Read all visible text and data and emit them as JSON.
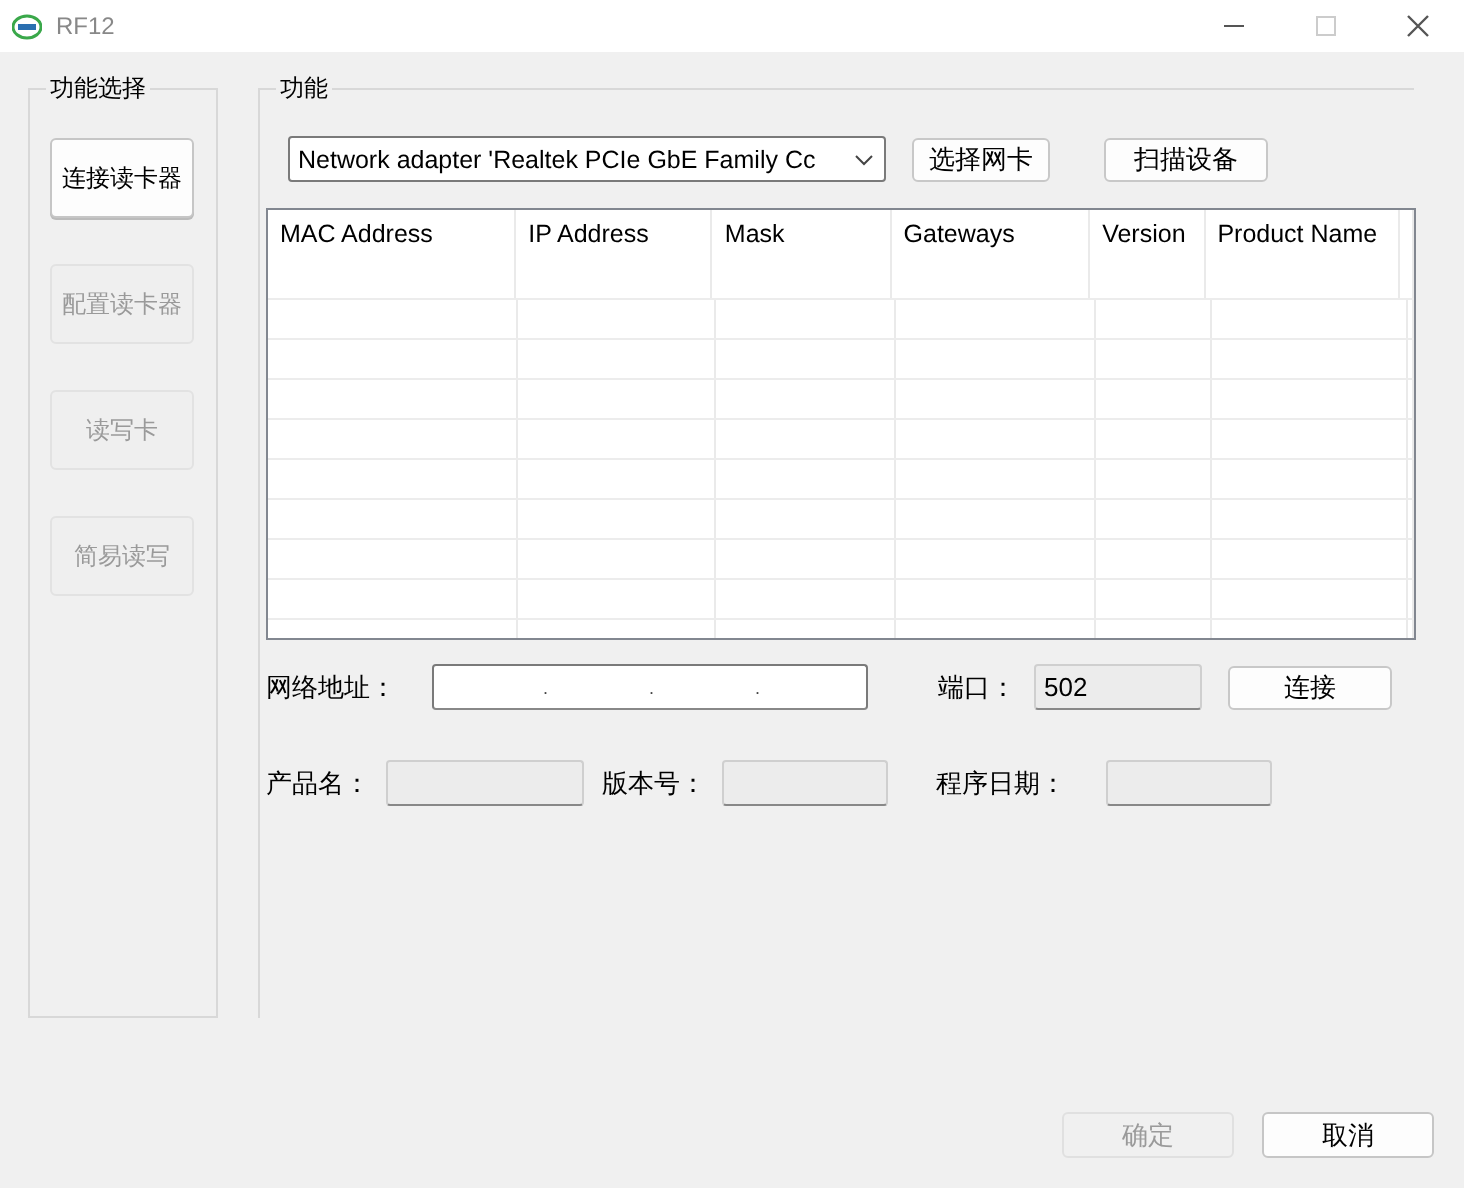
{
  "window": {
    "title": "RF12"
  },
  "sidebar": {
    "title": "功能选择",
    "items": [
      {
        "label": "连接读卡器",
        "selected": true,
        "disabled": false
      },
      {
        "label": "配置读卡器",
        "selected": false,
        "disabled": true
      },
      {
        "label": "读写卡",
        "selected": false,
        "disabled": true
      },
      {
        "label": "简易读写",
        "selected": false,
        "disabled": true
      }
    ]
  },
  "panel": {
    "title": "功能",
    "adapter": {
      "value": "Network adapter 'Realtek PCIe GbE Family Cc"
    },
    "select_adapter_button": "选择网卡",
    "scan_button": "扫描设备",
    "table": {
      "columns": [
        "MAC Address",
        "IP Address",
        "Mask",
        "Gateways",
        "Version",
        "Product Name"
      ]
    },
    "address": {
      "label": "网络地址：",
      "separators": [
        ".",
        ".",
        "."
      ]
    },
    "port": {
      "label": "端口：",
      "value": "502"
    },
    "connect_button": "连接",
    "product": {
      "label": "产品名："
    },
    "version": {
      "label": "版本号："
    },
    "date": {
      "label": "程序日期："
    }
  },
  "buttons": [
    {
      "label": "确定",
      "disabled": true
    },
    {
      "label": "取消",
      "disabled": false
    }
  ]
}
